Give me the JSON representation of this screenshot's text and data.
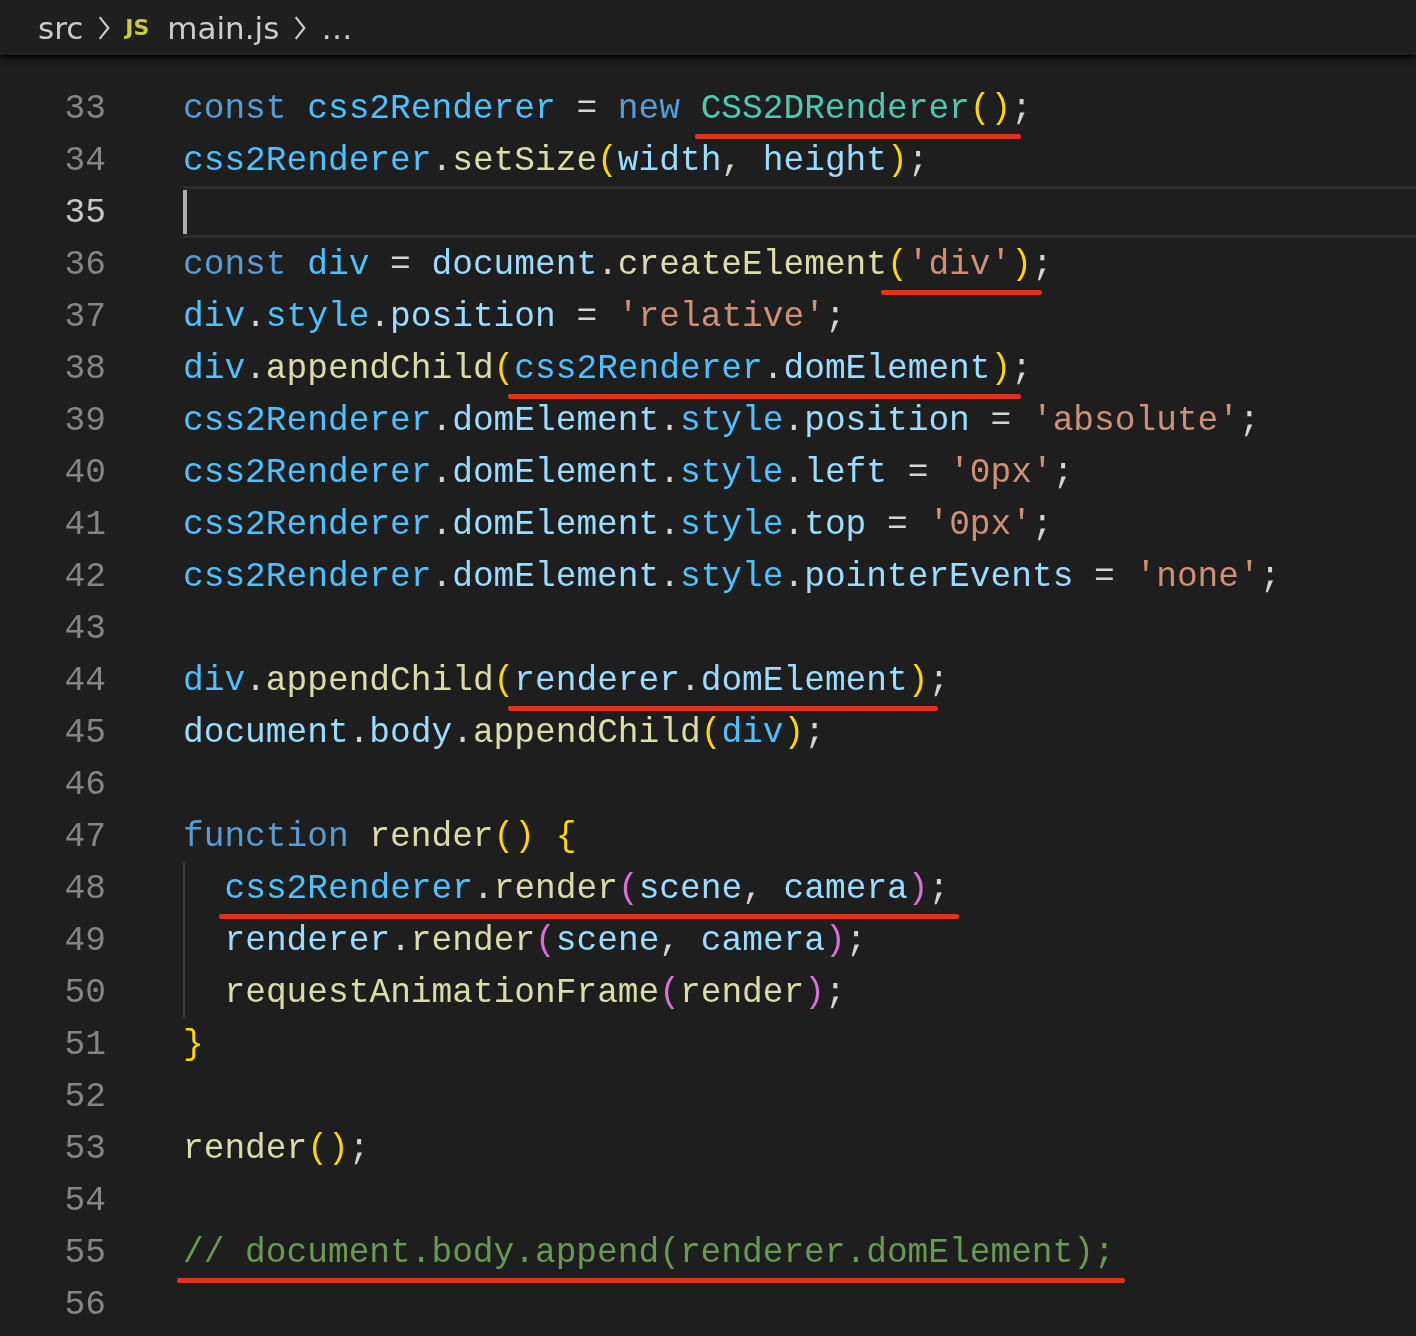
{
  "breadcrumb": [
    {
      "label": "src",
      "kind": "folder"
    },
    {
      "label": "main.js",
      "kind": "file",
      "file_icon": "JS"
    },
    {
      "label": "…",
      "kind": "more"
    }
  ],
  "lines": [
    {
      "number": "33",
      "current": false,
      "tokens": [
        {
          "text": "const ",
          "kind": "keyword"
        },
        {
          "text": "css2Renderer",
          "kind": "constant"
        },
        {
          "text": " = ",
          "kind": "punct"
        },
        {
          "text": "new ",
          "kind": "keyword"
        },
        {
          "kind": "underline",
          "tokens": [
            {
              "text": "CSS2DRenderer",
              "kind": "class"
            },
            {
              "text": "()",
              "kind": "bracket1"
            }
          ]
        },
        {
          "text": ";",
          "kind": "punct"
        }
      ]
    },
    {
      "number": "34",
      "current": false,
      "tokens": [
        {
          "text": "css2Renderer",
          "kind": "constant"
        },
        {
          "text": ".",
          "kind": "punct"
        },
        {
          "text": "setSize",
          "kind": "function"
        },
        {
          "text": "(",
          "kind": "bracket1"
        },
        {
          "text": "width",
          "kind": "variable"
        },
        {
          "text": ", ",
          "kind": "punct"
        },
        {
          "text": "height",
          "kind": "variable"
        },
        {
          "text": ")",
          "kind": "bracket1"
        },
        {
          "text": ";",
          "kind": "punct"
        }
      ]
    },
    {
      "number": "35",
      "current": true
    },
    {
      "number": "36",
      "current": false,
      "tokens": [
        {
          "text": "const ",
          "kind": "keyword"
        },
        {
          "text": "div",
          "kind": "constant"
        },
        {
          "text": " = ",
          "kind": "punct"
        },
        {
          "text": "document",
          "kind": "variable"
        },
        {
          "text": ".",
          "kind": "punct"
        },
        {
          "text": "createElement",
          "kind": "function"
        },
        {
          "kind": "underline",
          "tokens": [
            {
              "text": "(",
              "kind": "bracket1"
            },
            {
              "text": "'div'",
              "kind": "string"
            },
            {
              "text": ")",
              "kind": "bracket1"
            }
          ]
        },
        {
          "text": ";",
          "kind": "punct"
        }
      ]
    },
    {
      "number": "37",
      "current": false,
      "tokens": [
        {
          "text": "div",
          "kind": "constant"
        },
        {
          "text": ".",
          "kind": "punct"
        },
        {
          "text": "style",
          "kind": "constant"
        },
        {
          "text": ".",
          "kind": "punct"
        },
        {
          "text": "position",
          "kind": "variable"
        },
        {
          "text": " = ",
          "kind": "punct"
        },
        {
          "text": "'relative'",
          "kind": "string"
        },
        {
          "text": ";",
          "kind": "punct"
        }
      ]
    },
    {
      "number": "38",
      "current": false,
      "tokens": [
        {
          "text": "div",
          "kind": "constant"
        },
        {
          "text": ".",
          "kind": "punct"
        },
        {
          "text": "appendChild",
          "kind": "function"
        },
        {
          "text": "(",
          "kind": "bracket1"
        },
        {
          "kind": "underline",
          "tokens": [
            {
              "text": "css2Renderer",
              "kind": "constant"
            },
            {
              "text": ".domElement",
              "kind": "member"
            },
            {
              "text": ")",
              "kind": "bracket1"
            }
          ]
        },
        {
          "text": ";",
          "kind": "punct"
        }
      ]
    },
    {
      "number": "39",
      "current": false,
      "tokens": [
        {
          "text": "css2Renderer",
          "kind": "constant"
        },
        {
          "text": ".",
          "kind": "punct"
        },
        {
          "text": "domElement",
          "kind": "variable"
        },
        {
          "text": ".",
          "kind": "punct"
        },
        {
          "text": "style",
          "kind": "constant"
        },
        {
          "text": ".",
          "kind": "punct"
        },
        {
          "text": "position",
          "kind": "variable"
        },
        {
          "text": " = ",
          "kind": "punct"
        },
        {
          "text": "'absolute'",
          "kind": "string"
        },
        {
          "text": ";",
          "kind": "punct"
        }
      ]
    },
    {
      "number": "40",
      "current": false,
      "tokens": [
        {
          "text": "css2Renderer",
          "kind": "constant"
        },
        {
          "text": ".",
          "kind": "punct"
        },
        {
          "text": "domElement",
          "kind": "variable"
        },
        {
          "text": ".",
          "kind": "punct"
        },
        {
          "text": "style",
          "kind": "constant"
        },
        {
          "text": ".",
          "kind": "punct"
        },
        {
          "text": "left",
          "kind": "variable"
        },
        {
          "text": " = ",
          "kind": "punct"
        },
        {
          "text": "'0px'",
          "kind": "string"
        },
        {
          "text": ";",
          "kind": "punct"
        }
      ]
    },
    {
      "number": "41",
      "current": false,
      "tokens": [
        {
          "text": "css2Renderer",
          "kind": "constant"
        },
        {
          "text": ".",
          "kind": "punct"
        },
        {
          "text": "domElement",
          "kind": "variable"
        },
        {
          "text": ".",
          "kind": "punct"
        },
        {
          "text": "style",
          "kind": "constant"
        },
        {
          "text": ".",
          "kind": "punct"
        },
        {
          "text": "top",
          "kind": "variable"
        },
        {
          "text": " = ",
          "kind": "punct"
        },
        {
          "text": "'0px'",
          "kind": "string"
        },
        {
          "text": ";",
          "kind": "punct"
        }
      ]
    },
    {
      "number": "42",
      "current": false,
      "tokens": [
        {
          "text": "css2Renderer",
          "kind": "constant"
        },
        {
          "text": ".",
          "kind": "punct"
        },
        {
          "text": "domElement",
          "kind": "variable"
        },
        {
          "text": ".",
          "kind": "punct"
        },
        {
          "text": "style",
          "kind": "constant"
        },
        {
          "text": ".",
          "kind": "punct"
        },
        {
          "text": "pointerEvents",
          "kind": "variable"
        },
        {
          "text": " = ",
          "kind": "punct"
        },
        {
          "text": "'none'",
          "kind": "string"
        },
        {
          "text": ";",
          "kind": "punct"
        }
      ]
    },
    {
      "number": "43",
      "current": false
    },
    {
      "number": "44",
      "current": false,
      "tokens": [
        {
          "text": "div",
          "kind": "constant"
        },
        {
          "text": ".",
          "kind": "punct"
        },
        {
          "text": "appendChild",
          "kind": "function"
        },
        {
          "text": "(",
          "kind": "bracket1"
        },
        {
          "kind": "underline",
          "tokens": [
            {
              "text": "renderer",
              "kind": "variable"
            },
            {
              "text": ".domElement",
              "kind": "member"
            },
            {
              "text": ")",
              "kind": "bracket1"
            }
          ]
        },
        {
          "text": ";",
          "kind": "punct"
        }
      ]
    },
    {
      "number": "45",
      "current": false,
      "tokens": [
        {
          "text": "document",
          "kind": "variable"
        },
        {
          "text": ".",
          "kind": "punct"
        },
        {
          "text": "body",
          "kind": "variable"
        },
        {
          "text": ".",
          "kind": "punct"
        },
        {
          "text": "appendChild",
          "kind": "function"
        },
        {
          "text": "(",
          "kind": "bracket1"
        },
        {
          "text": "div",
          "kind": "constant"
        },
        {
          "text": ")",
          "kind": "bracket1"
        },
        {
          "text": ";",
          "kind": "punct"
        }
      ]
    },
    {
      "number": "46",
      "current": false
    },
    {
      "number": "47",
      "current": false,
      "tokens": [
        {
          "text": "function ",
          "kind": "keyword"
        },
        {
          "text": "render",
          "kind": "function"
        },
        {
          "text": "() {",
          "kind": "bracket1"
        }
      ],
      "children": [
        {
          "number": "48",
          "current": false,
          "tokens": [
            {
              "kind": "underline",
              "tokens": [
                {
                  "text": "css2Renderer",
                  "kind": "constant"
                },
                {
                  "text": ".",
                  "kind": "punct"
                },
                {
                  "text": "render",
                  "kind": "function"
                },
                {
                  "text": "(",
                  "kind": "bracket2"
                },
                {
                  "text": "scene",
                  "kind": "variable"
                },
                {
                  "text": ", ",
                  "kind": "punct"
                },
                {
                  "text": "camera",
                  "kind": "variable"
                },
                {
                  "text": ")",
                  "kind": "bracket2"
                },
                {
                  "text": ";",
                  "kind": "punct"
                }
              ]
            }
          ]
        },
        {
          "number": "49",
          "current": false,
          "tokens": [
            {
              "text": "renderer",
              "kind": "variable"
            },
            {
              "text": ".",
              "kind": "punct"
            },
            {
              "text": "render",
              "kind": "function"
            },
            {
              "text": "(",
              "kind": "bracket2"
            },
            {
              "text": "scene",
              "kind": "variable"
            },
            {
              "text": ", ",
              "kind": "punct"
            },
            {
              "text": "camera",
              "kind": "variable"
            },
            {
              "text": ")",
              "kind": "bracket2"
            },
            {
              "text": ";",
              "kind": "punct"
            }
          ]
        },
        {
          "number": "50",
          "current": false,
          "tokens": [
            {
              "text": "requestAnimationFrame",
              "kind": "function"
            },
            {
              "text": "(",
              "kind": "bracket2"
            },
            {
              "text": "render",
              "kind": "function"
            },
            {
              "text": ")",
              "kind": "bracket2"
            },
            {
              "text": ";",
              "kind": "punct"
            }
          ]
        }
      ]
    },
    {
      "number": "51",
      "current": false,
      "tokens": [
        {
          "text": "}",
          "kind": "bracket1"
        }
      ]
    },
    {
      "number": "52",
      "current": false
    },
    {
      "number": "53",
      "current": false,
      "tokens": [
        {
          "text": "render",
          "kind": "function"
        },
        {
          "text": "()",
          "kind": "bracket1"
        },
        {
          "text": ";",
          "kind": "punct"
        }
      ]
    },
    {
      "number": "54",
      "current": false
    },
    {
      "number": "55",
      "current": false,
      "tokens": [
        {
          "kind": "underline",
          "tokens": [
            {
              "text": "// document.body.append(renderer.domElement);",
              "kind": "comment"
            }
          ]
        }
      ]
    },
    {
      "number": "56",
      "current": false
    }
  ]
}
